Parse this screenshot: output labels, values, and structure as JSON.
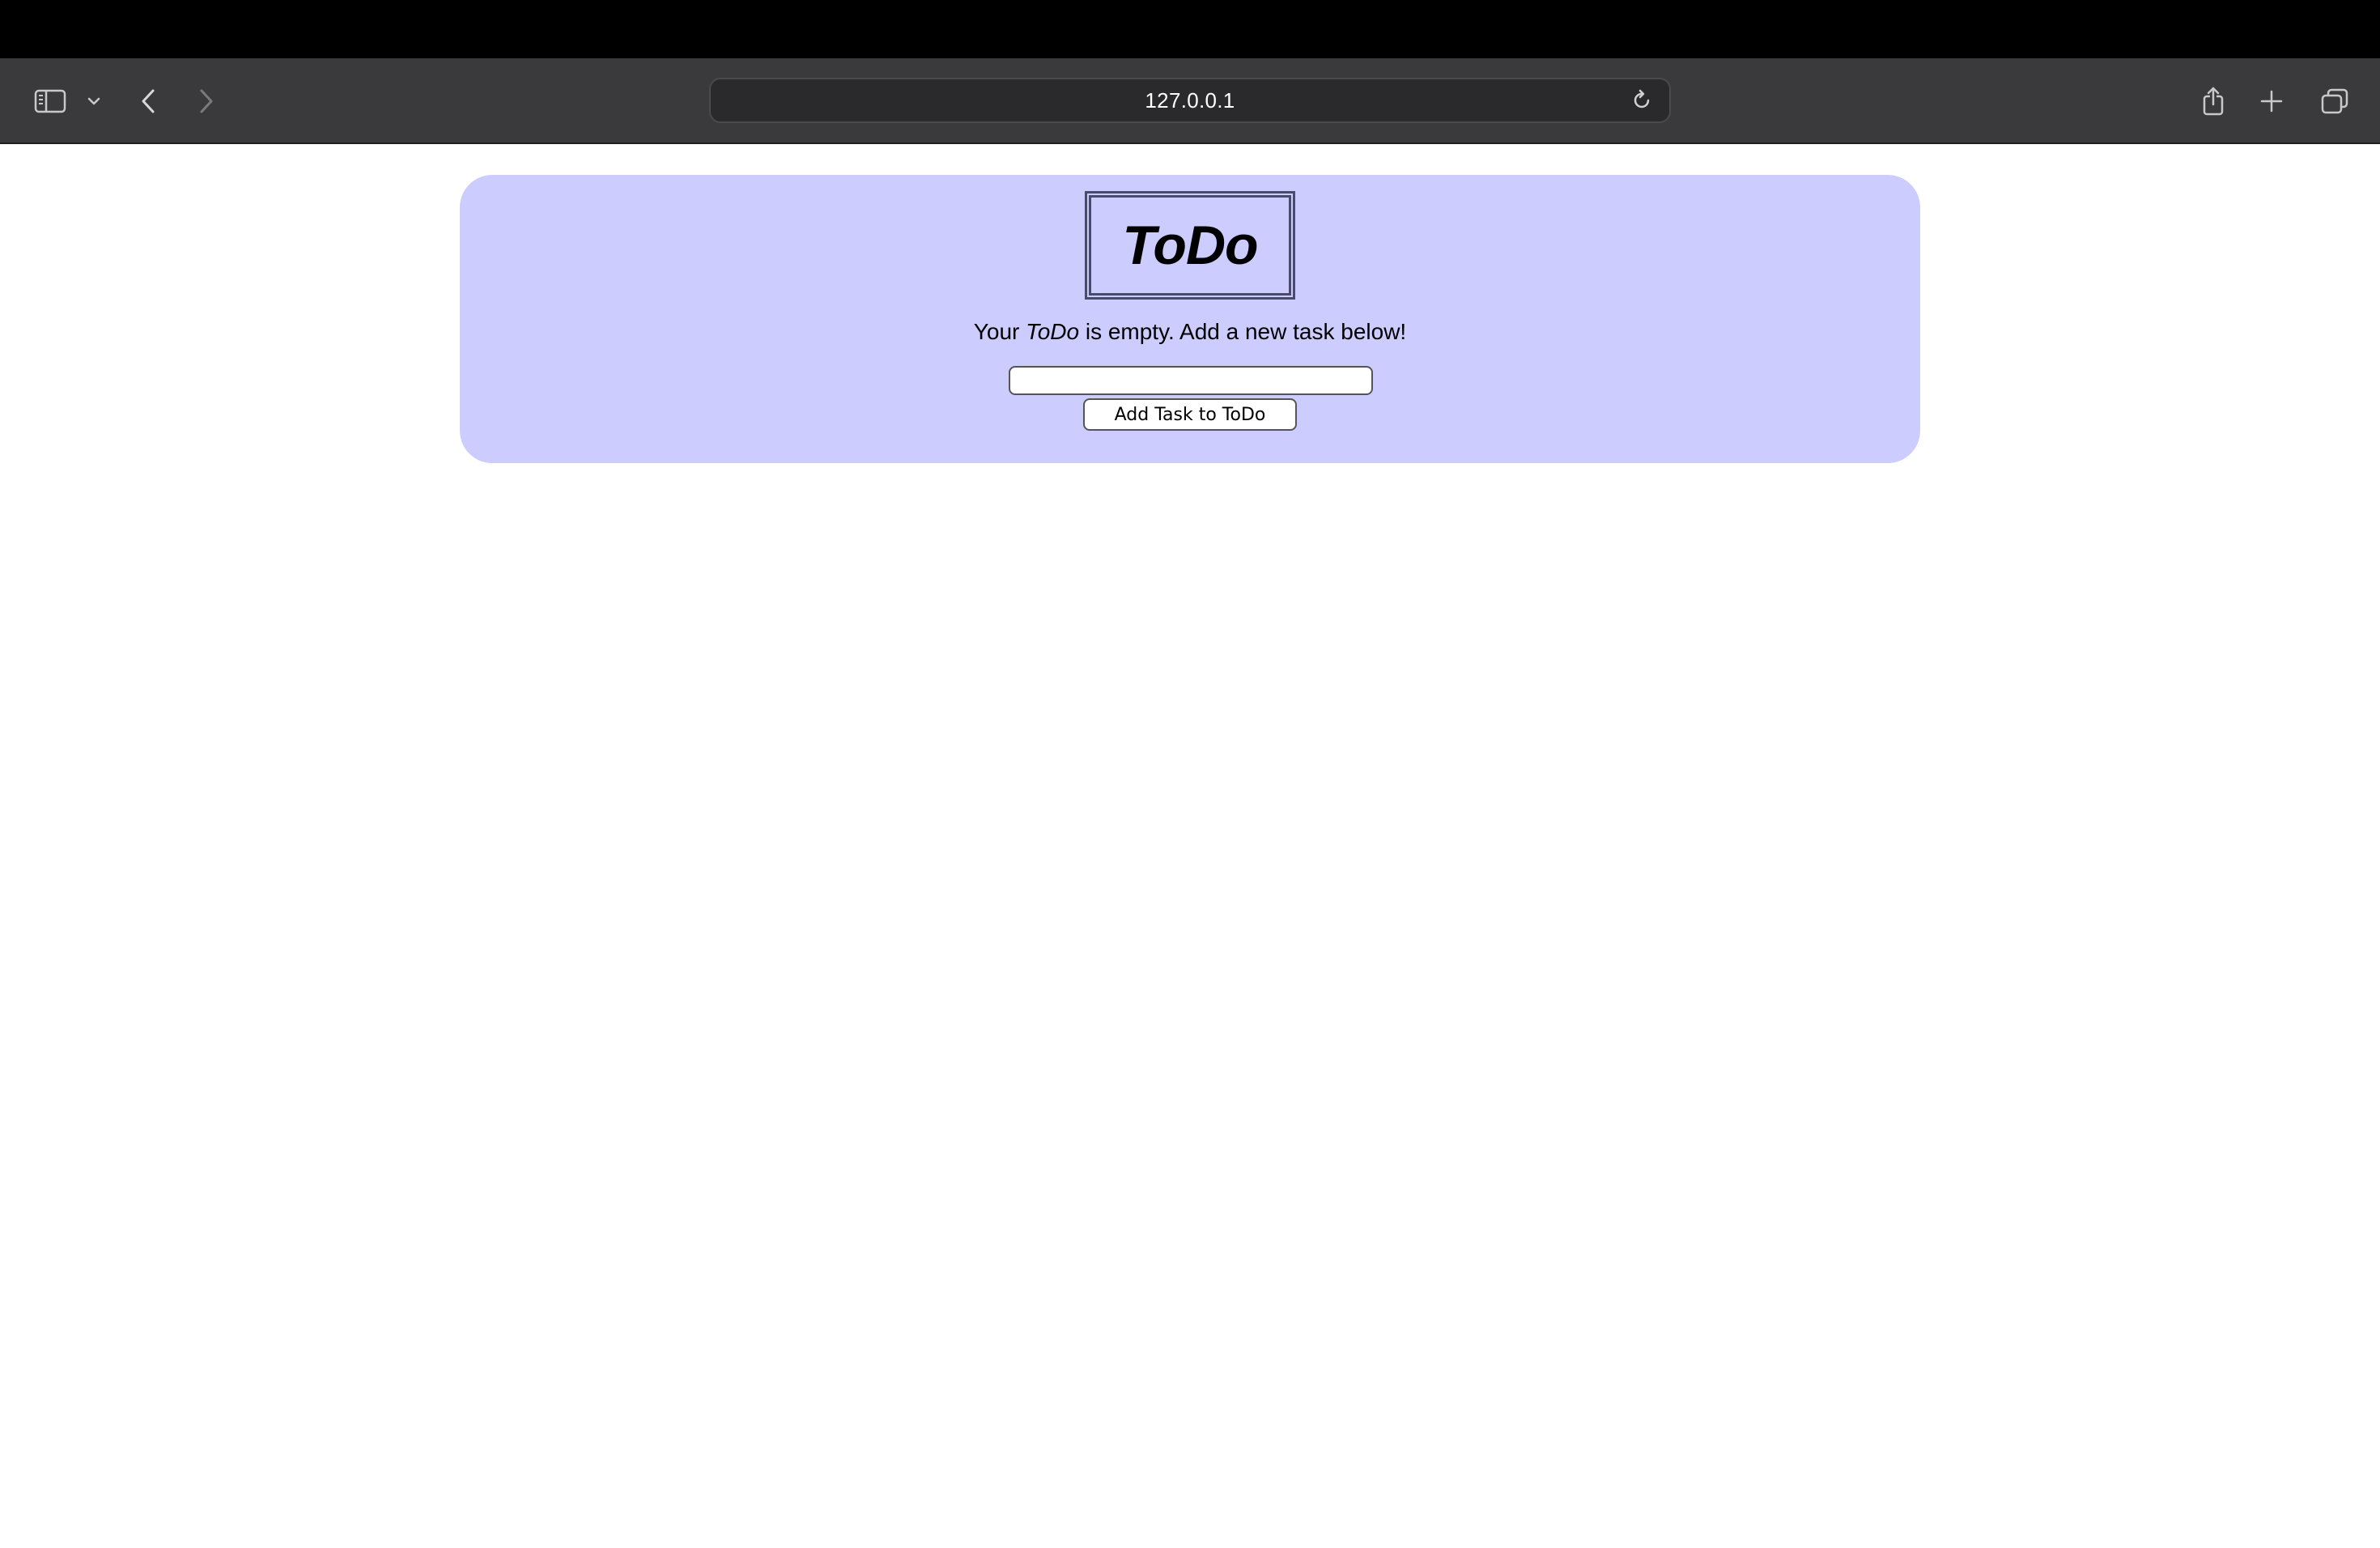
{
  "browser": {
    "url": "127.0.0.1",
    "icons": {
      "sidebar": "sidebar-icon",
      "sidebar_menu": "chevron-down-icon",
      "back": "chevron-left-icon",
      "forward": "chevron-right-icon",
      "reload": "reload-icon",
      "share": "share-icon",
      "new_tab": "plus-icon",
      "tabs_overview": "tabs-icon"
    }
  },
  "page": {
    "logo": "ToDo",
    "empty_prefix": "Your ",
    "empty_app_name": "ToDo",
    "empty_suffix": " is empty. Add a new task below!",
    "input_value": "",
    "add_button_label": "Add Task to ToDo"
  },
  "colors": {
    "card_background": "#ccccff",
    "toolbar_background": "#3a3a3c",
    "menubar_background": "#000000"
  }
}
